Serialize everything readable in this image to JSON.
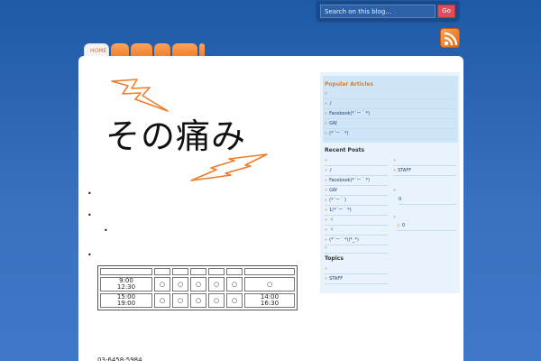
{
  "search": {
    "placeholder": "Search on this blog...",
    "go_label": "Go"
  },
  "nav": {
    "tabs": [
      "HOME",
      "",
      "",
      "",
      "",
      ""
    ]
  },
  "logo": {
    "title": "その痛み"
  },
  "main": {
    "schedule": {
      "header": [
        "",
        "",
        "",
        "",
        "",
        "",
        ""
      ],
      "rows": [
        [
          "9:00\n12:30",
          "○",
          "○",
          "○",
          "○",
          "○",
          "○"
        ],
        [
          "15:00\n19:00",
          "○",
          "○",
          "○",
          "○",
          "○",
          "14:00\n16:30"
        ]
      ]
    },
    "phone": "03-6458-5984"
  },
  "sidebar": {
    "popular_title": "Popular Articles",
    "popular_items": [
      "",
      "♪",
      "Facebook(*´ー｀*)",
      "GW",
      "(*´ー｀*)"
    ],
    "recent_title": "Recent Posts",
    "recent_left": [
      "",
      "♪",
      "Facebook(*´ー｀*)",
      "GW",
      "(*´ー｀)",
      "1(*´ー｀*)",
      "ヾ",
      "ヾ",
      "(*´ー｀*)(*_*)",
      ""
    ],
    "recent_right": [
      "",
      "STAFF",
      "",
      "0",
      "",
      "0"
    ],
    "topics_title": "Topics",
    "topics_items": [
      "",
      "STAFF"
    ]
  },
  "colors": {
    "accent": "#e07a24",
    "background": "#3a72c0",
    "go_button": "#e04c5c"
  }
}
